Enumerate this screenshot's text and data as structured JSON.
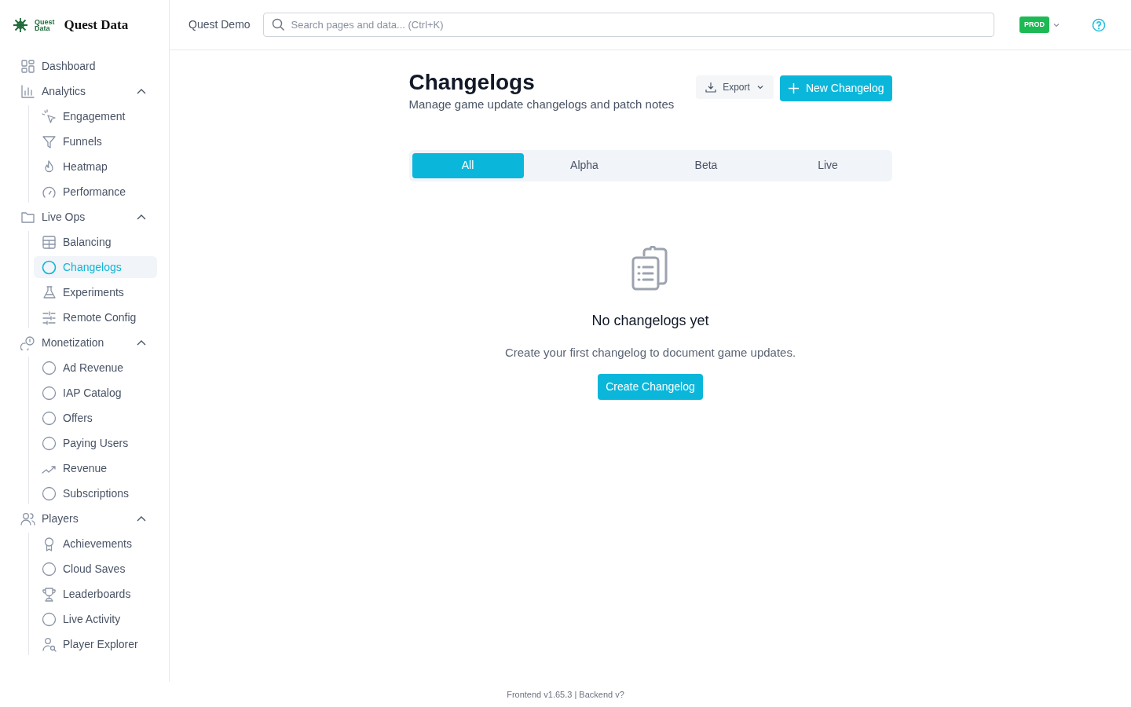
{
  "brand": {
    "name": "Quest Data",
    "logo_text": [
      "Quest",
      "Data"
    ]
  },
  "sidebar": {
    "items": [
      {
        "label": "Dashboard",
        "selected": false
      },
      {
        "label": "Analytics",
        "expanded": true,
        "children": [
          {
            "label": "Engagement",
            "selected": false
          },
          {
            "label": "Funnels",
            "selected": false
          },
          {
            "label": "Heatmap",
            "selected": false
          },
          {
            "label": "Performance",
            "selected": false
          }
        ]
      },
      {
        "label": "Live Ops",
        "expanded": true,
        "children": [
          {
            "label": "Balancing",
            "selected": false
          },
          {
            "label": "Changelogs",
            "selected": true
          },
          {
            "label": "Experiments",
            "selected": false
          },
          {
            "label": "Remote Config",
            "selected": false
          }
        ]
      },
      {
        "label": "Monetization",
        "expanded": true,
        "children": [
          {
            "label": "Ad Revenue",
            "selected": false
          },
          {
            "label": "IAP Catalog",
            "selected": false
          },
          {
            "label": "Offers",
            "selected": false
          },
          {
            "label": "Paying Users",
            "selected": false
          },
          {
            "label": "Revenue",
            "selected": false
          },
          {
            "label": "Subscriptions",
            "selected": false
          }
        ]
      },
      {
        "label": "Players",
        "expanded": true,
        "children": [
          {
            "label": "Achievements",
            "selected": false
          },
          {
            "label": "Cloud Saves",
            "selected": false
          },
          {
            "label": "Leaderboards",
            "selected": false
          },
          {
            "label": "Live Activity",
            "selected": false
          },
          {
            "label": "Player Explorer",
            "selected": false
          }
        ]
      }
    ]
  },
  "topbar": {
    "project": "Quest Demo",
    "search": {
      "placeholder": "Search pages and data... (Ctrl+K)"
    },
    "environment": "PROD"
  },
  "page": {
    "title": "Changelogs",
    "subtitle": "Manage game update changelogs and patch notes",
    "export_button": "Export",
    "new_button": "New Changelog",
    "tabs": [
      {
        "label": "All",
        "selected": true
      },
      {
        "label": "Alpha",
        "selected": false
      },
      {
        "label": "Beta",
        "selected": false
      },
      {
        "label": "Live",
        "selected": false
      }
    ],
    "empty": {
      "title": "No changelogs yet",
      "text": "Create your first changelog to document game updates.",
      "button": "Create Changelog"
    }
  },
  "footer": "Frontend v1.65.3 | Backend v?"
}
